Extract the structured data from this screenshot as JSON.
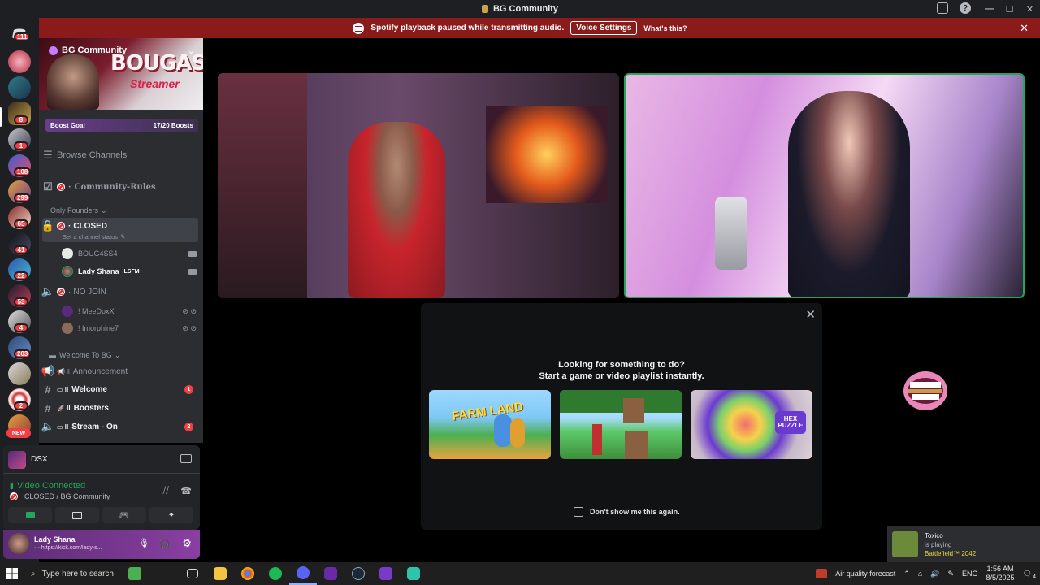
{
  "window": {
    "title": "BG Community"
  },
  "notice": {
    "message": "Spotify playback paused while transmitting audio.",
    "voice_settings": "Voice Settings",
    "whats_this": "What's this?"
  },
  "rail": {
    "badges": [
      "111",
      "8",
      "1",
      "108",
      "299",
      "65",
      "41",
      "22",
      "53",
      "4",
      "203",
      "2"
    ],
    "new_label": "NEW"
  },
  "server": {
    "name": "BG Community",
    "banner_text": "BOUGASSAA",
    "banner_sub": "Streamer",
    "boost_goal": "Boost Goal",
    "boost_count": "17/20 Boosts",
    "browse_channels": "Browse Channels"
  },
  "channels": {
    "community_rules": "Community-Rules",
    "only_founders": "Only Founders",
    "closed": "CLOSED",
    "closed_status": "Set a channel status",
    "users_closed": [
      {
        "name": "BOUG4SS4"
      },
      {
        "name": "Lady Shana",
        "tag": "LSFM"
      }
    ],
    "no_join": "NO JOIN",
    "users_nojoin": [
      {
        "name": "! MeeDoxX"
      },
      {
        "name": "! Imorphine7"
      }
    ],
    "welcome_cat": "Welcome To BG",
    "announcement": "Announcement",
    "welcome": "Welcome",
    "welcome_badge": "1",
    "boosters": "Boosters",
    "stream_on": "Stream - On",
    "stream_badge": "2"
  },
  "voice_panel": {
    "stream_name": "DSX",
    "status": "Video Connected",
    "location": "CLOSED / BG Community"
  },
  "user_panel": {
    "name": "Lady Shana",
    "status": "https://kick.com/lady-s..."
  },
  "popup": {
    "line1": "Looking for something to do?",
    "line2": "Start a game or video playlist instantly.",
    "games": [
      "FARM LAND",
      "",
      "HEX PUZZLE"
    ],
    "dont_show": "Don't show me this again."
  },
  "toast": {
    "name": "Toxico",
    "activity": "is playing",
    "game": "Battlefield™ 2042"
  },
  "taskbar": {
    "search_placeholder": "Type here to search",
    "weather": "Air quality forecast",
    "lang": "ENG",
    "time": "1:56 AM",
    "date": "8/5/2025",
    "notif_count": "4"
  },
  "colors": {
    "accent_red": "#8b1a1a",
    "online_green": "#23a55a",
    "badge_red": "#f23f43"
  }
}
